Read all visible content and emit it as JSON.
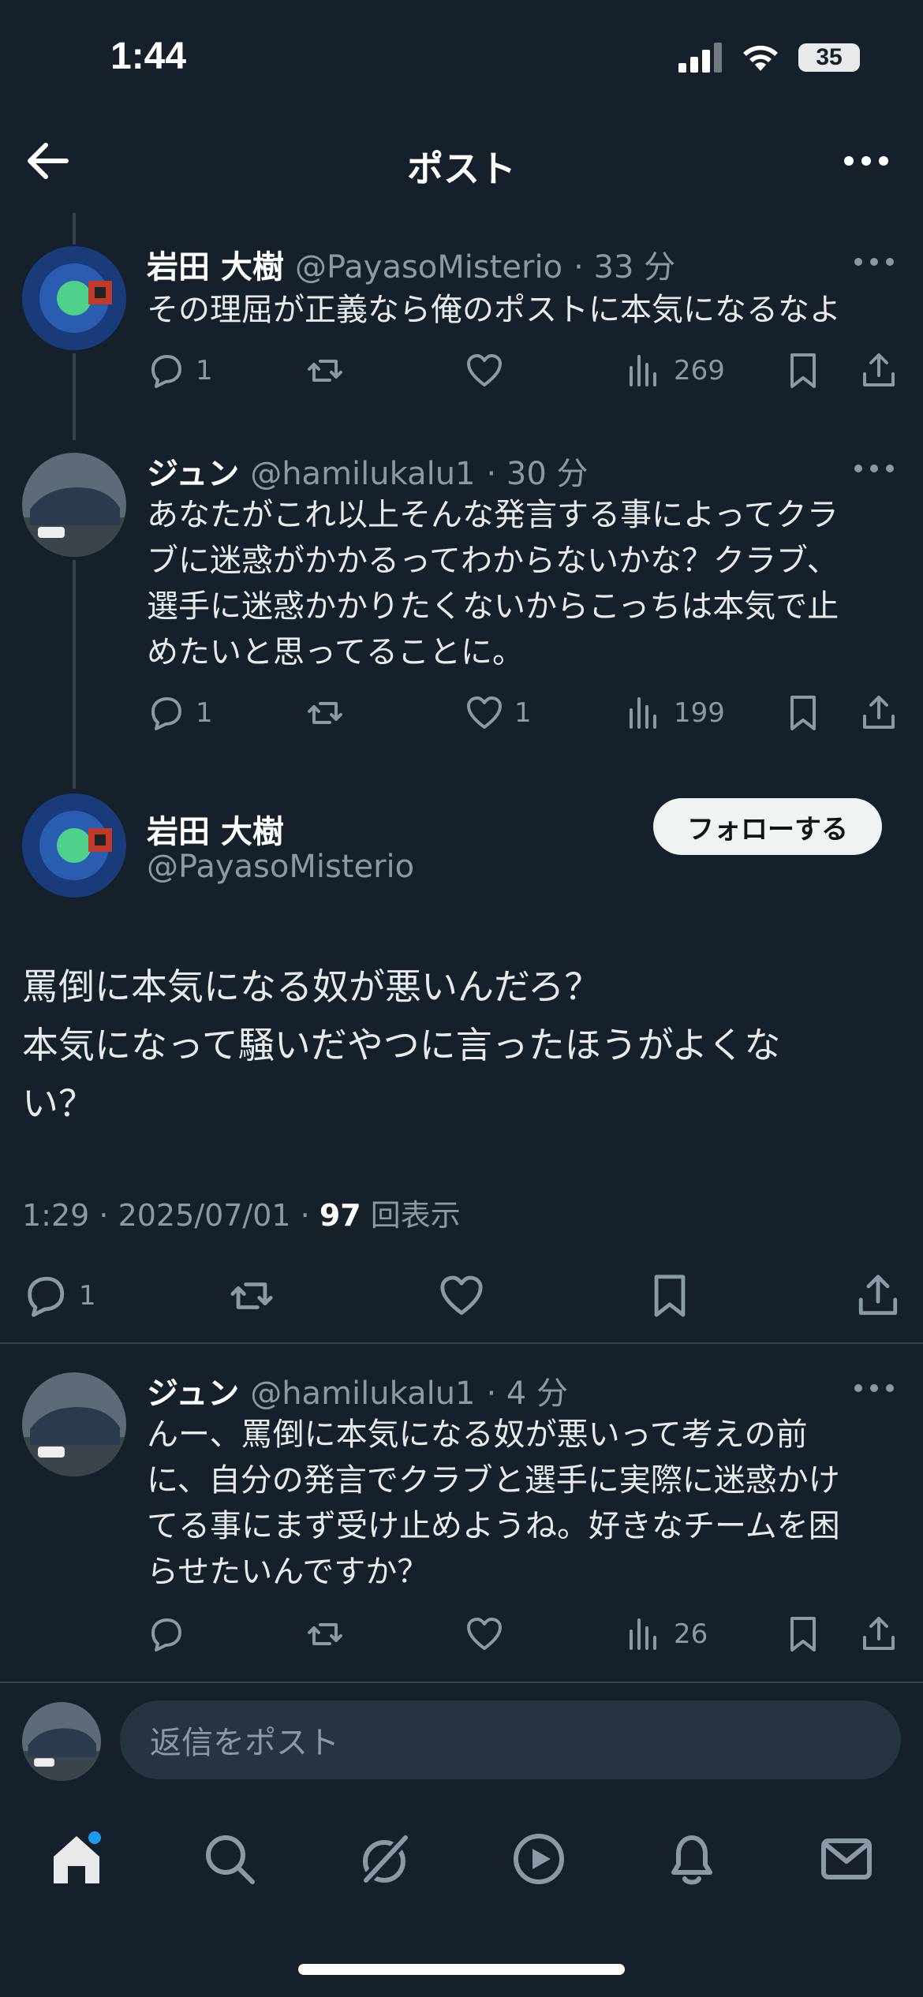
{
  "status_bar": {
    "time": "1:44",
    "battery": "35"
  },
  "header": {
    "title": "ポスト"
  },
  "tweets": [
    {
      "name": "岩田 大樹",
      "handle": "@PayasoMisterio",
      "time": "· 33 分",
      "text": "その理屈が正義なら俺のポストに本気になるなよ",
      "replies": "1",
      "likes": "",
      "views": "269"
    },
    {
      "name": "ジュン",
      "handle": "@hamilukalu1",
      "time": "· 30 分",
      "text_lines": [
        "あなたがこれ以上そんな発言する事によってクラ",
        "ブに迷惑がかかるってわからないかな？クラブ、",
        "選手に迷惑かかりたくないからこっちは本気で止",
        "めたいと思ってることに。"
      ],
      "replies": "1",
      "likes": "1",
      "views": "199"
    }
  ],
  "main_post": {
    "name": "岩田 大樹",
    "handle": "@PayasoMisterio",
    "follow_label": "フォローする",
    "text_lines": [
      "罵倒に本気になる奴が悪いんだろ？",
      "本気になって騒いだやつに言ったほうがよくな",
      "い？"
    ],
    "timestamp": "1:29 · 2025/07/01 · ",
    "views_count": "97",
    "views_label": " 回表示",
    "replies": "1"
  },
  "reply": {
    "name": "ジュン",
    "handle": "@hamilukalu1",
    "time": "· 4 分",
    "text_lines": [
      "んー、罵倒に本気になる奴が悪いって考えの前",
      "に、自分の発言でクラブと選手に実際に迷惑かけ",
      "てる事にまず受け止めようね。好きなチームを困",
      "らせたいんですか？"
    ],
    "views": "26"
  },
  "reply_bar": {
    "placeholder": "返信をポスト"
  },
  "colors": {
    "background": "#15202b",
    "secondary_text": "#8b98a5",
    "accent": "#1d9bf0"
  },
  "tab_bar": [
    "home-icon",
    "search-icon",
    "grok-icon",
    "video-icon",
    "notifications-icon",
    "messages-icon"
  ]
}
